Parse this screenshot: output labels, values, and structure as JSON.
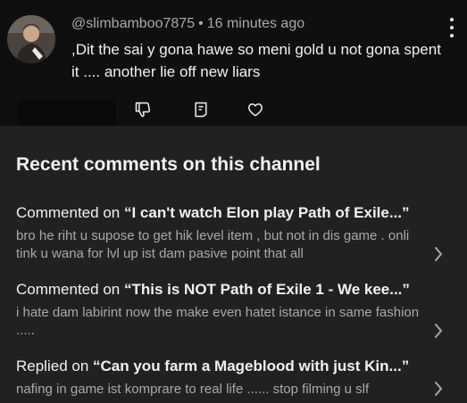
{
  "comment": {
    "author": "@slimbamboo7875",
    "separator": "•",
    "timestamp": "16 minutes ago",
    "text": ",Dit the sai y gona hawe so meni gold u not gona spent it .... another lie off new liars",
    "icons": {
      "like": "thumb-up-icon",
      "dislike": "thumb-down-icon",
      "reply": "reply-icon",
      "heart": "heart-icon",
      "menu": "more-vertical-icon"
    }
  },
  "panel": {
    "title": "Recent comments on this channel",
    "items": [
      {
        "verb": "Commented on",
        "video": "“I can't watch Elon play Path of Exile...”",
        "text": "bro he riht u supose to get hik level item , but not in dis game . onli tink u wana for lvl up ist dam pasive point that all"
      },
      {
        "verb": "Commented on",
        "video": "“This is NOT Path of Exile 1 - We kee...”",
        "text": "i hate dam labirint now the make even hatet istance in same fashion ....."
      },
      {
        "verb": "Replied on",
        "video": "“Can you farm a Mageblood with just Kin...”",
        "text": "nafing in game ist komprare to real life ...... stop filming u slf"
      }
    ]
  },
  "colors": {
    "top_bg": "#0f0f0f",
    "panel_bg": "#212121",
    "primary_text": "#f1f1f1",
    "secondary_text": "#aaaaaa"
  }
}
